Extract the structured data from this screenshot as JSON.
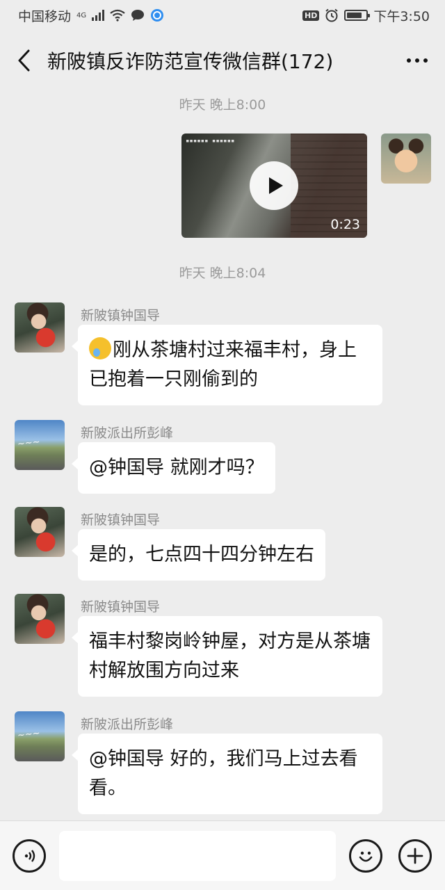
{
  "status_bar": {
    "carrier": "中国移动",
    "network": "4G",
    "hd_badge": "HD",
    "time": "下午3:50",
    "battery_level": 0.8
  },
  "header": {
    "title": "新陂镇反诈防范宣传微信群(172)"
  },
  "chat": {
    "timestamps": [
      "昨天 晚上8:00",
      "昨天 晚上8:04"
    ],
    "video_message": {
      "duration": "0:23"
    },
    "messages": [
      {
        "sender": "新陂镇钟国导",
        "text": "刚从茶塘村过来福丰村，身上已抱着一只刚偷到的",
        "emoji": "crying-laughing-emoji"
      },
      {
        "sender": "新陂派出所彭峰",
        "text": "@钟国导  就刚才吗？"
      },
      {
        "sender": "新陂镇钟国导",
        "text": "是的，七点四十四分钟左右"
      },
      {
        "sender": "新陂镇钟国导",
        "text": "福丰村黎岗岭钟屋，对方是从茶塘村解放围方向过来"
      },
      {
        "sender": "新陂派出所彭峰",
        "text": "@钟国导  好的，我们马上过去看看。"
      }
    ]
  },
  "input_bar": {
    "voice_icon": "voice-icon",
    "emoji_icon": "smiley-icon",
    "plus_icon": "plus-icon",
    "value": ""
  }
}
